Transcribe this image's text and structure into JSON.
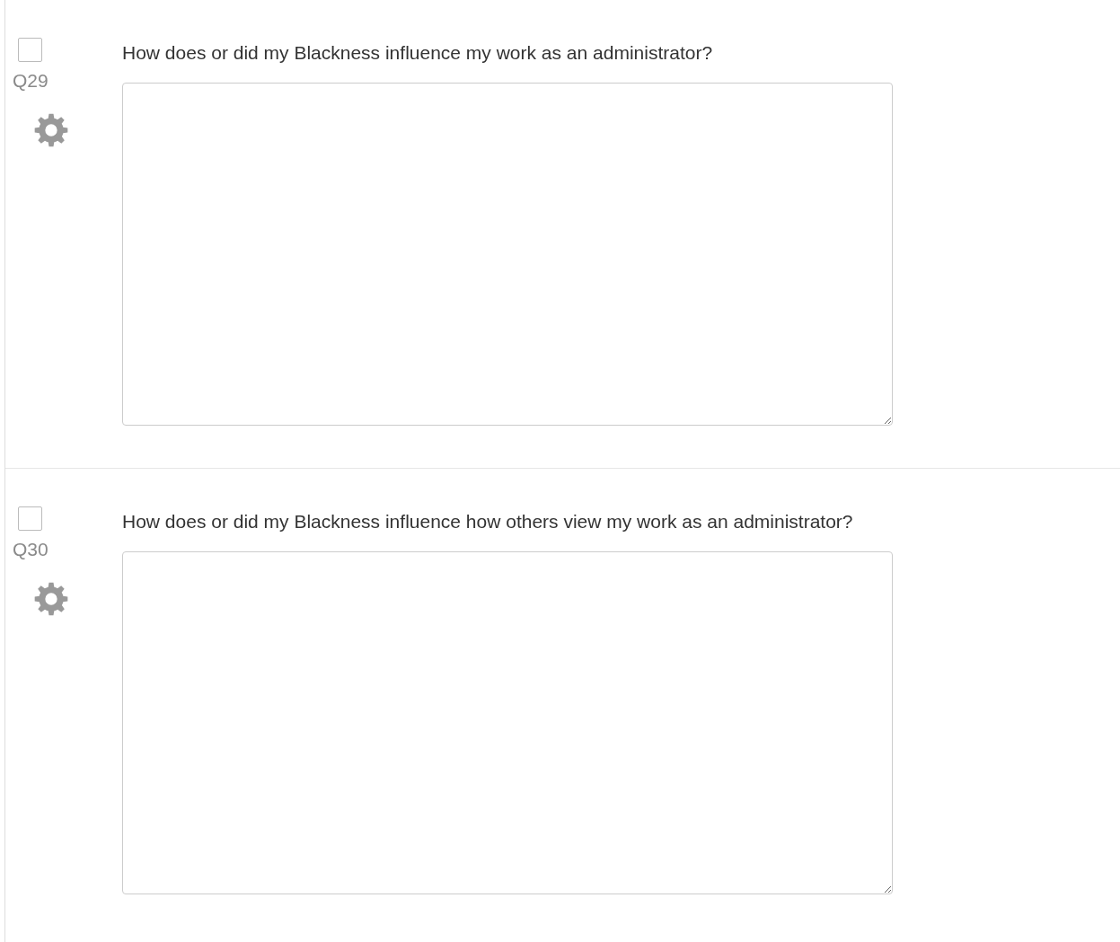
{
  "questions": [
    {
      "number": "Q29",
      "checked": false,
      "text": "How does or did my Blackness influence my work as an administrator?"
    },
    {
      "number": "Q30",
      "checked": false,
      "text": "How does or did my Blackness influence how others view my work as an administrator?"
    }
  ]
}
